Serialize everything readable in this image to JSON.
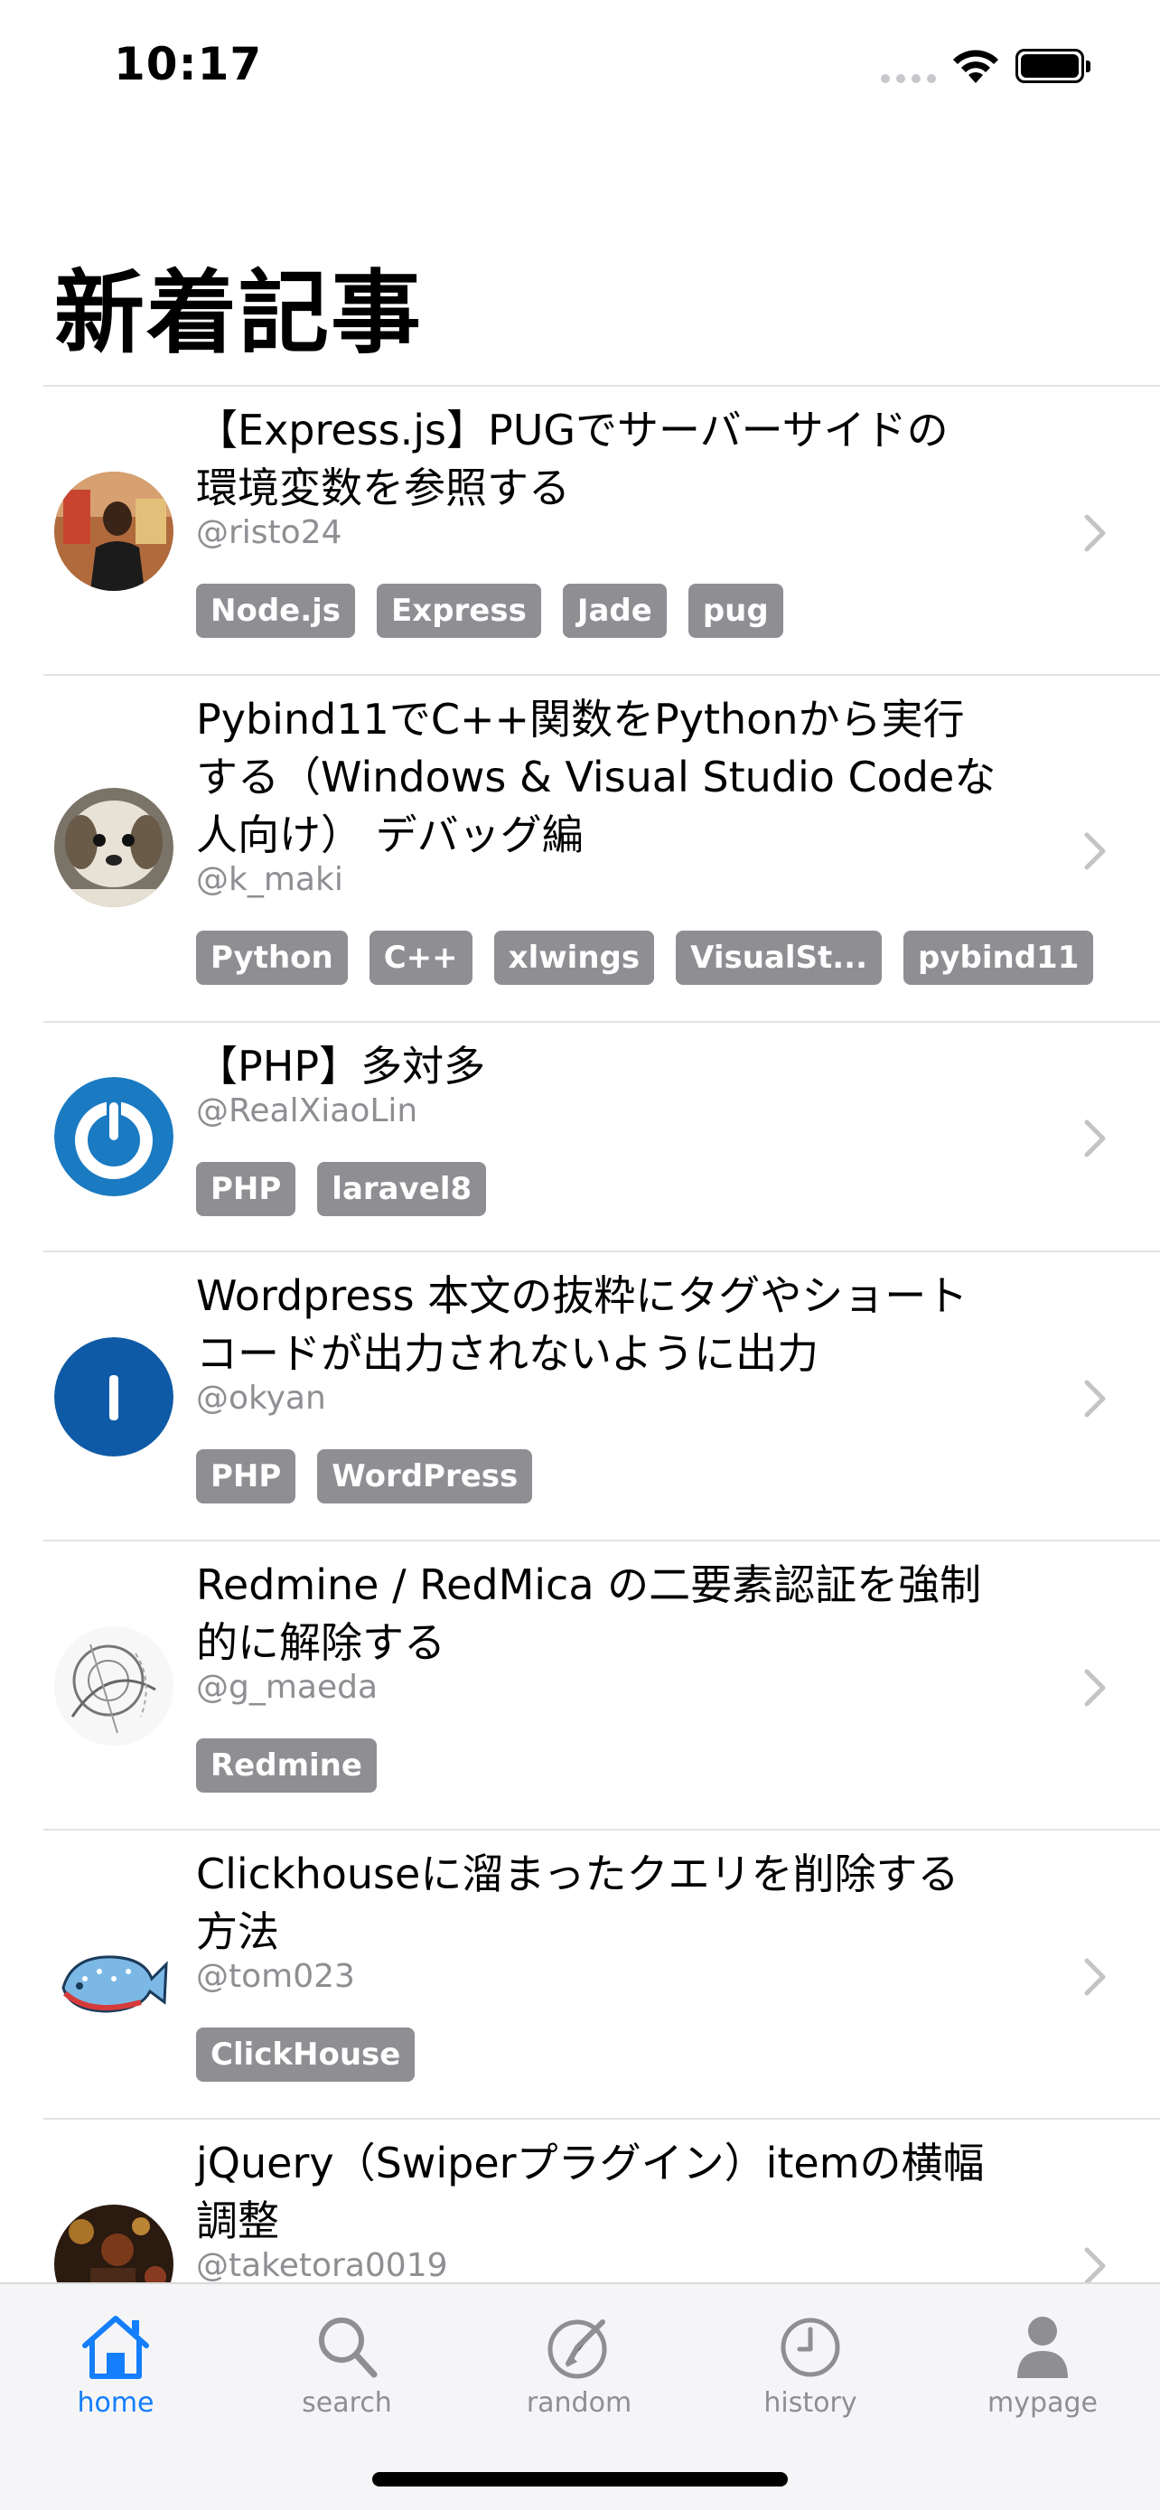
{
  "status_bar": {
    "time": "10:17"
  },
  "header": {
    "title": "新着記事"
  },
  "articles": [
    {
      "title_lines": [
        "【Express.js】PUGでサーバーサイドの",
        "環境変数を参照する"
      ],
      "author": "@risto24",
      "tags": [
        "Node.js",
        "Express",
        "Jade",
        "pug"
      ]
    },
    {
      "title_lines": [
        "Pybind11でC++関数をPythonから実行",
        "する（Windows & Visual Studio Codeな",
        "人向け） デバッグ編"
      ],
      "author": "@k_maki",
      "tags": [
        "Python",
        "C++",
        "xlwings",
        "VisualSt...",
        "pybind11"
      ]
    },
    {
      "title_lines": [
        "【PHP】多対多"
      ],
      "author": "@RealXiaoLin",
      "tags": [
        "PHP",
        "laravel8"
      ]
    },
    {
      "title_lines": [
        "Wordpress 本文の抜粋にタグやショート",
        "コードが出力されないように出力"
      ],
      "author": "@okyan",
      "tags": [
        "PHP",
        "WordPress"
      ]
    },
    {
      "title_lines": [
        "Redmine / RedMica の二要素認証を強制",
        "的に解除する"
      ],
      "author": "@g_maeda",
      "tags": [
        "Redmine"
      ]
    },
    {
      "title_lines": [
        "Clickhouseに溜まったクエリを削除する",
        "方法"
      ],
      "author": "@tom023",
      "tags": [
        "ClickHouse"
      ]
    },
    {
      "title_lines": [
        "jQuery（Swiperプラグイン）itemの横幅",
        "調整"
      ],
      "author": "@taketora0019",
      "tags": []
    }
  ],
  "tab_bar": {
    "active_color": "#147efb",
    "inactive_color": "#8e8e93",
    "items": [
      {
        "label": "home",
        "icon": "house-icon",
        "active": true
      },
      {
        "label": "search",
        "icon": "magnifier-icon",
        "active": false
      },
      {
        "label": "random",
        "icon": "compass-pencil-icon",
        "active": false
      },
      {
        "label": "history",
        "icon": "clock-icon",
        "active": false
      },
      {
        "label": "mypage",
        "icon": "person-icon",
        "active": false
      }
    ]
  }
}
